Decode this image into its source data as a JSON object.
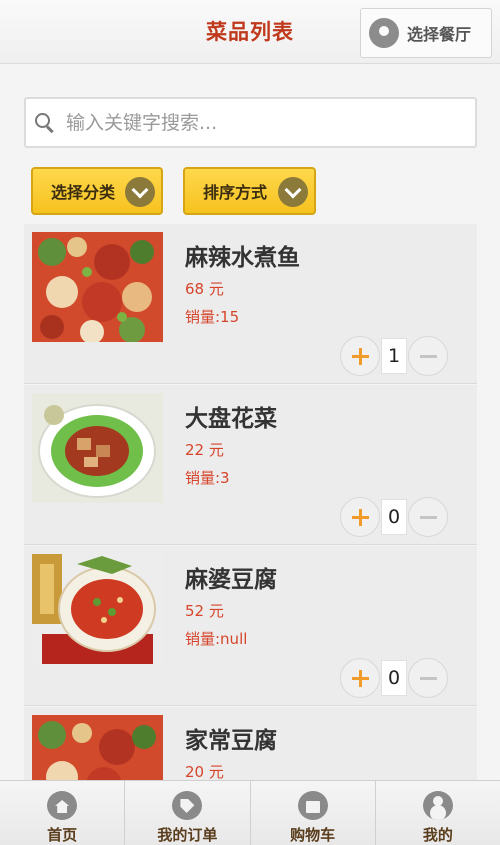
{
  "header": {
    "title": "菜品列表",
    "select_restaurant_label": "选择餐厅"
  },
  "search": {
    "placeholder": "输入关键字搜索..."
  },
  "filters": {
    "category_label": "选择分类",
    "sort_label": "排序方式"
  },
  "dishes": [
    {
      "name": "麻辣水煮鱼",
      "price": "68 元",
      "sales": "销量:15",
      "qty": "1"
    },
    {
      "name": "大盘花菜",
      "price": "22 元",
      "sales": "销量:3",
      "qty": "0"
    },
    {
      "name": "麻婆豆腐",
      "price": "52 元",
      "sales": "销量:null",
      "qty": "0"
    },
    {
      "name": "家常豆腐",
      "price": "20 元",
      "sales": "",
      "qty": ""
    }
  ],
  "bottom_nav": {
    "items": [
      {
        "label": "首页",
        "icon": "home-icon"
      },
      {
        "label": "我的订单",
        "icon": "tag-icon"
      },
      {
        "label": "购物车",
        "icon": "shopping-bag-icon"
      },
      {
        "label": "我的",
        "icon": "user-icon"
      }
    ]
  },
  "colors": {
    "title_red": "#c0391c",
    "price_red": "#d6452b",
    "filter_yellow": "#f6c21f",
    "plus_orange": "#f29b2a"
  }
}
